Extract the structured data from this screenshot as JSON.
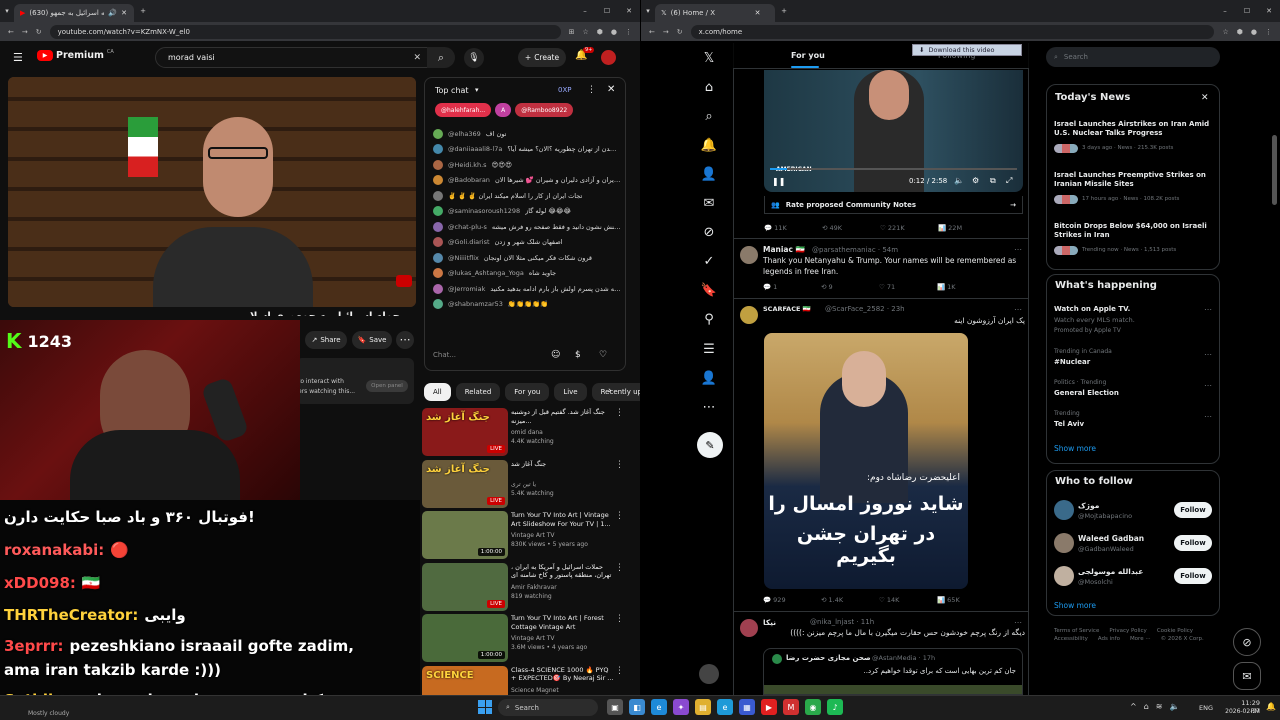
{
  "left_browser": {
    "tab_title": "(630) حمله اسرائیل به جمهو...",
    "url": "youtube.com/watch?v=KZmNX-W_el0",
    "yt": {
      "logo_text": "Premium",
      "logo_super": "CA",
      "search_value": "morad vaisi",
      "create_label": "Create",
      "notif_count": "9+",
      "share_label": "Share",
      "save_label": "Save",
      "interact_text_1": "to interact with",
      "interact_text_2": "ers watching this...",
      "open_panel_label": "Open panel",
      "title_fragment": "حمله اسرائیل به جمهوری اسلا"
    },
    "chat": {
      "header": "Top chat",
      "points": "0XP",
      "pinned": [
        "@halehfarah...",
        "A",
        "@Ramboo8922"
      ],
      "messages": [
        {
          "author": "@elha369",
          "text": "تون اف"
        },
        {
          "author": "@daniiaaali8-l7a",
          "text": "وضعیت خارج شدن از تهران چطوریه ؟الان؟ میشه آیا؟"
        },
        {
          "author": "@Heidi.kh.s",
          "text": "😍😍😍"
        },
        {
          "author": "@Badobaran",
          "text": "تبریک به ایران و آزادی دلیران و شیران 💕 شیرها الان 🔥🔥"
        },
        {
          "author": "",
          "text": "✌️ ✌️ ✌️ تجات ایران از کار را اسلام میکند ایران"
        },
        {
          "author": "@saminasoroush1298",
          "text": "لوله گاز 😂😂😂"
        },
        {
          "author": "@chat-plu-s",
          "text": "اب بمزمه رو چراه دانلود سیزنم صبح واکنش نشون دانید و فقط صفحه رو فرش میشه"
        },
        {
          "author": "@Goli.diarist",
          "text": "اصفهان شلک شهر و زدن"
        },
        {
          "author": "@Niiiitflix",
          "text": "قرون شکات فکر میکنی مثلا الان اونجان"
        },
        {
          "author": "@lukas_Ashtanga_Yoga",
          "text": "جاوید شاه"
        },
        {
          "author": "@Jerromiak",
          "text": "جناب وبسی بجاز کشته شدن پسرم اولش باز بارم ادامه بدهید مکنید"
        },
        {
          "author": "@shabnamzar53",
          "text": "👏👏👏👏👏"
        }
      ],
      "input_placeholder": "Chat..."
    },
    "filters": [
      "All",
      "Related",
      "For you",
      "Live",
      "Recently up"
    ],
    "recs": [
      {
        "title": "جنگ آغاز شد. گفتیم قبل از دوشنبه میزنه...",
        "channel": "omid dana",
        "meta": "4.4K watching",
        "badge": "LIVE",
        "thumb_text": "جنگ آغاز شد",
        "thumb_color": "#8a1a1a"
      },
      {
        "title": "جنگ آغاز شد",
        "channel": "یا تین تری",
        "meta": "5.4K watching",
        "badge": "LIVE",
        "thumb_text": "جنگ آغاز شد",
        "thumb_color": "#6a5a3a"
      },
      {
        "title": "Turn Your TV Into Art | Vintage Art Slideshow For Your TV | 1...",
        "channel": "Vintage Art TV",
        "meta": "830K views • 5 years ago",
        "badge": "1:00:00",
        "thumb_text": "",
        "thumb_color": "#6b7a4a"
      },
      {
        "title": "حملات اسرائیل و آمریکا به ایران ، تهران، منطقه پاستور و کاخ شامنه ای را هدف",
        "channel": "Amir Fakhravar",
        "meta": "819 watching",
        "badge": "LIVE",
        "thumb_text": "",
        "thumb_color": "#506a40"
      },
      {
        "title": "Turn Your TV Into Art | Forest Cottage Vintage Art Slideshow...",
        "channel": "Vintage Art TV",
        "meta": "3.6M views • 4 years ago",
        "badge": "1:00:00",
        "thumb_text": "",
        "thumb_color": "#4a6a3a"
      },
      {
        "title": "Class-4 SCIENCE 1000 🔥 PYQ + EXPECTED🎯 By Neeraj Sir ...",
        "channel": "Science Magnet",
        "meta": "",
        "badge": "",
        "thumb_text": "SCIENCE",
        "thumb_color": "#c76a20"
      }
    ],
    "overlay": {
      "kick_count": "1243",
      "lines": [
        {
          "text": "فوتبال ۳۶۰ و باد صبا حکایت دارن!",
          "color": "#ffffff"
        },
        {
          "text": "roxanakabi:",
          "color": "#ff5a5a",
          "extra": "🔴"
        },
        {
          "text": "xDD098:",
          "color": "#ff4a4a",
          "extra": "🇮🇷"
        },
        {
          "text": "THRTheCreator:",
          "color": "#ffd23c",
          "extra": "وایبی"
        },
        {
          "text": "3eprrr:",
          "color": "#ff4a4a",
          "extra": "pezeshkiano israaail gofte zadim,"
        },
        {
          "text": "ama iran takzib karde :)))",
          "color": "#ffffff"
        },
        {
          "text": "Setidia:",
          "color": "#ffd23c",
          "extra": "پزشکیان زدن نمی‌خوان صداشو درارن"
        }
      ]
    }
  },
  "right_browser": {
    "tab_title": "(6) Home / X",
    "url": "x.com/home",
    "tabs": [
      "For you",
      "Following"
    ],
    "download_label": "Download this video",
    "video_time": "0:12 / 2:58",
    "video_caption": "AMERICAN",
    "community_notes": "Rate proposed Community Notes",
    "posts": [
      {
        "name": "",
        "handle": "",
        "text": "",
        "actions": [
          "11K",
          "49K",
          "221K",
          "22M"
        ]
      },
      {
        "name": "Maniac 🇮🇷",
        "handle": "@parsathemaniac · 54m",
        "text": "Thank you Netanyahu & Trump. Your names will be remembered as legends in free Iran.",
        "actions": [
          "1",
          "9",
          "71",
          "1K"
        ]
      },
      {
        "name": "SCARFACE 🇮🇷",
        "handle": "@ScarFace_2582 · 23h",
        "text": "یک ایران آرزوشون اینه",
        "image_subtitle": "اعلیحضرت رضاشاه دوم:",
        "image_line1": "شاید نوروز امسال را",
        "image_line2": "در تهران جشن بگیریم",
        "actions": [
          "929",
          "1.4K",
          "14K",
          "65K"
        ]
      },
      {
        "name": "نیکا",
        "handle": "@nika_lnjast · 11h",
        "text": "دیگه از رنگ پرچم خودشون حس حقارت میگیرن با مال ما پرچم میزنن :))))",
        "quote_name": "صحن مجازی حضرت رضا",
        "quote_handle": "@AstanMedia · 17h",
        "quote_text": "جان کم ترین بهایی است که برای توقدا خواهیم کرد.."
      }
    ],
    "search_placeholder": "Search",
    "news": {
      "header": "Today's News",
      "items": [
        {
          "title": "Israel Launches Airstrikes on Iran Amid U.S. Nuclear Talks Progress",
          "meta": "3 days ago · News · 215.3K posts"
        },
        {
          "title": "Israel Launches Preemptive Strikes on Iranian Missile Sites",
          "meta": "17 hours ago · News · 108.2K posts"
        },
        {
          "title": "Bitcoin Drops Below $64,000 on Israeli Strikes in Iran",
          "meta": "Trending now · News · 1,513 posts"
        }
      ]
    },
    "happening": {
      "header": "What's happening",
      "items": [
        {
          "sub": "",
          "title": "Watch on Apple TV.",
          "extra": "Watch every MLS match.",
          "promo": "Promoted by Apple TV"
        },
        {
          "sub": "Trending in Canada",
          "title": "#Nuclear"
        },
        {
          "sub": "Politics · Trending",
          "title": "General Election"
        },
        {
          "sub": "Trending",
          "title": "Tel Aviv"
        }
      ],
      "show_more": "Show more"
    },
    "who_to_follow": {
      "header": "Who to follow",
      "items": [
        {
          "name": "موژک",
          "handle": "@Mojtabapacino",
          "button": "Follow"
        },
        {
          "name": "Waleed Gadban",
          "handle": "@GadbanWaleed",
          "button": "Follow"
        },
        {
          "name": "عبدالله موسولجی",
          "handle": "@Mosolchi",
          "button": "Follow"
        }
      ],
      "show_more": "Show more"
    },
    "footer": [
      "Terms of Service",
      "Privacy Policy",
      "Cookie Policy",
      "Accessibility",
      "Ads info",
      "More ···",
      "© 2026 X Corp."
    ]
  },
  "taskbar": {
    "weather": "Mostly cloudy",
    "search_placeholder": "Search",
    "lang": "ENG",
    "time": "11:29 PM",
    "date": "2026-02-27"
  }
}
